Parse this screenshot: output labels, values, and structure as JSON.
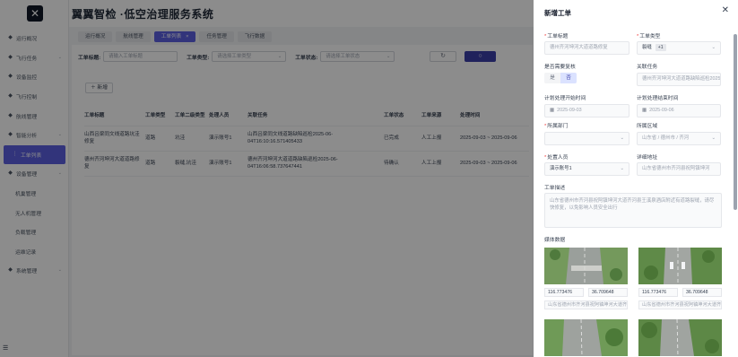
{
  "app": {
    "title": "翼翼智检 ·低空治理服务系统"
  },
  "sidebar": {
    "items": [
      {
        "label": "运行概况",
        "icon": "home-icon",
        "sub": false,
        "chevron": false
      },
      {
        "label": "飞行任务",
        "icon": "plane-icon",
        "sub": false,
        "chevron": true
      },
      {
        "label": "设备监控",
        "icon": "monitor-icon",
        "sub": false,
        "chevron": false
      },
      {
        "label": "飞行控制",
        "icon": "control-icon",
        "sub": false,
        "chevron": false
      },
      {
        "label": "航线管理",
        "icon": "route-icon",
        "sub": false,
        "chevron": false
      },
      {
        "label": "智能分析",
        "icon": "analysis-icon",
        "sub": false,
        "chevron": true
      },
      {
        "label": "工单列表",
        "icon": "list-icon",
        "sub": true,
        "active": true
      },
      {
        "label": "设备管理",
        "icon": "device-icon",
        "sub": false,
        "chevron": true
      },
      {
        "label": "机巢管理",
        "icon": "",
        "sub": true
      },
      {
        "label": "无人机管理",
        "icon": "",
        "sub": true
      },
      {
        "label": "负载管理",
        "icon": "",
        "sub": true
      },
      {
        "label": "运维记录",
        "icon": "",
        "sub": true
      },
      {
        "label": "系统管理",
        "icon": "settings-icon",
        "sub": false,
        "chevron": true
      }
    ]
  },
  "tabs": [
    {
      "label": "运行概况",
      "active": false
    },
    {
      "label": "航线管理",
      "active": false
    },
    {
      "label": "工单列表",
      "active": true
    },
    {
      "label": "任务管理",
      "active": false
    },
    {
      "label": "飞行数据",
      "active": false
    }
  ],
  "filters": {
    "title_label": "工单标题:",
    "title_placeholder": "请输入工单标题",
    "type_label": "工单类型:",
    "type_placeholder": "请选择工单类型",
    "status_label": "工单状态:",
    "status_placeholder": "请选择工单状态"
  },
  "toolbar": {
    "add_label": "新增"
  },
  "table": {
    "headers": [
      "工单标题",
      "工单类型",
      "工单二级类型",
      "处理人员",
      "关联任务",
      "工单状态",
      "工单来源",
      "处理时间"
    ],
    "rows": [
      [
        "山西吕梁同文线道路坑洼修复",
        "道路",
        "坑洼",
        "演示账号1",
        "山西吕梁同文线道路缺陷巡检2025-06-04T16:10:16.571405433",
        "已完成",
        "人工上报",
        "2025-09-03 ~ 2025-09-06"
      ],
      [
        "德州齐河坤河大道道路修复",
        "道路",
        "裂缝,坑洼",
        "演示账号1",
        "德州齐河坤河大道道路缺陷巡检2025-06-04T16:06:58.737647441",
        "待确认",
        "人工上报",
        "2025-09-03 ~ 2025-09-06"
      ]
    ]
  },
  "drawer": {
    "title": "新增工单",
    "fields": {
      "order_title": {
        "label": "工单标题",
        "placeholder": "德州齐河坤河大道道路修复"
      },
      "order_type": {
        "label": "工单类型",
        "value": "裂缝",
        "tag": "+1"
      },
      "need_review": {
        "label": "是否需要复核",
        "options": [
          "是",
          "否"
        ],
        "selected": "否"
      },
      "related_task": {
        "label": "关联任务",
        "value": "德州齐河坤河大道道路缺陷巡检2025"
      },
      "plan_start": {
        "label": "计划处理开始时间",
        "value": "2025-09-03"
      },
      "plan_end": {
        "label": "计划处理结束时间",
        "value": "2025-09-06"
      },
      "department": {
        "label": "所属部门",
        "value": ""
      },
      "region": {
        "label": "所属区域",
        "value": "山东省 / 德州市 / 齐河"
      },
      "handler": {
        "label": "处置人员",
        "value": "演示账号1"
      },
      "address": {
        "label": "详细地址",
        "value": "山东省德州市齐河县祝阿镇坤河"
      },
      "description": {
        "label": "工单描述",
        "value": "山东省德州市齐河县祝阿镇坤河大道齐河县王溪泉酒店附近有道路裂缝，请尽快修复，以免影响人员安全出行"
      },
      "media": {
        "label": "媒体数据"
      }
    },
    "media_items": [
      {
        "lng": "116.773476",
        "lat": "36.709648",
        "address": "山东省德州市齐河县祝阿镇坤河大道齐"
      },
      {
        "lng": "116.773476",
        "lat": "36.709648",
        "address": "山东省德州市齐河县祝阿镇坤河大道齐"
      }
    ]
  }
}
